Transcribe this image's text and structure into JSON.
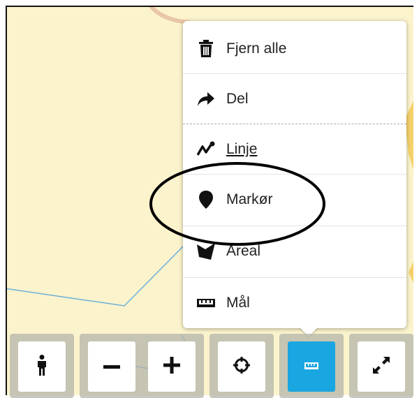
{
  "colors": {
    "map_background": "#fbf3cc",
    "road_line": "#6ab0d8",
    "active_button": "#1aa6e0",
    "annotation": "#000000"
  },
  "menu": {
    "items": [
      {
        "label": "Fjern alle",
        "icon": "trash-icon"
      },
      {
        "label": "Del",
        "icon": "share-arrow-icon"
      },
      {
        "label": "Linje",
        "icon": "line-draw-icon"
      },
      {
        "label": "Markør",
        "icon": "marker-icon"
      },
      {
        "label": "Areal",
        "icon": "area-polygon-icon"
      },
      {
        "label": "Mål",
        "icon": "ruler-icon"
      }
    ]
  },
  "toolbar": {
    "buttons": [
      {
        "name": "street-view-button",
        "icon": "person-icon"
      },
      {
        "name": "zoom-out-button",
        "icon": "minus-icon"
      },
      {
        "name": "zoom-in-button",
        "icon": "plus-icon"
      },
      {
        "name": "locate-button",
        "icon": "crosshair-icon"
      },
      {
        "name": "measure-button",
        "icon": "ruler-icon",
        "active": true
      },
      {
        "name": "fullscreen-button",
        "icon": "expand-icon"
      }
    ]
  }
}
